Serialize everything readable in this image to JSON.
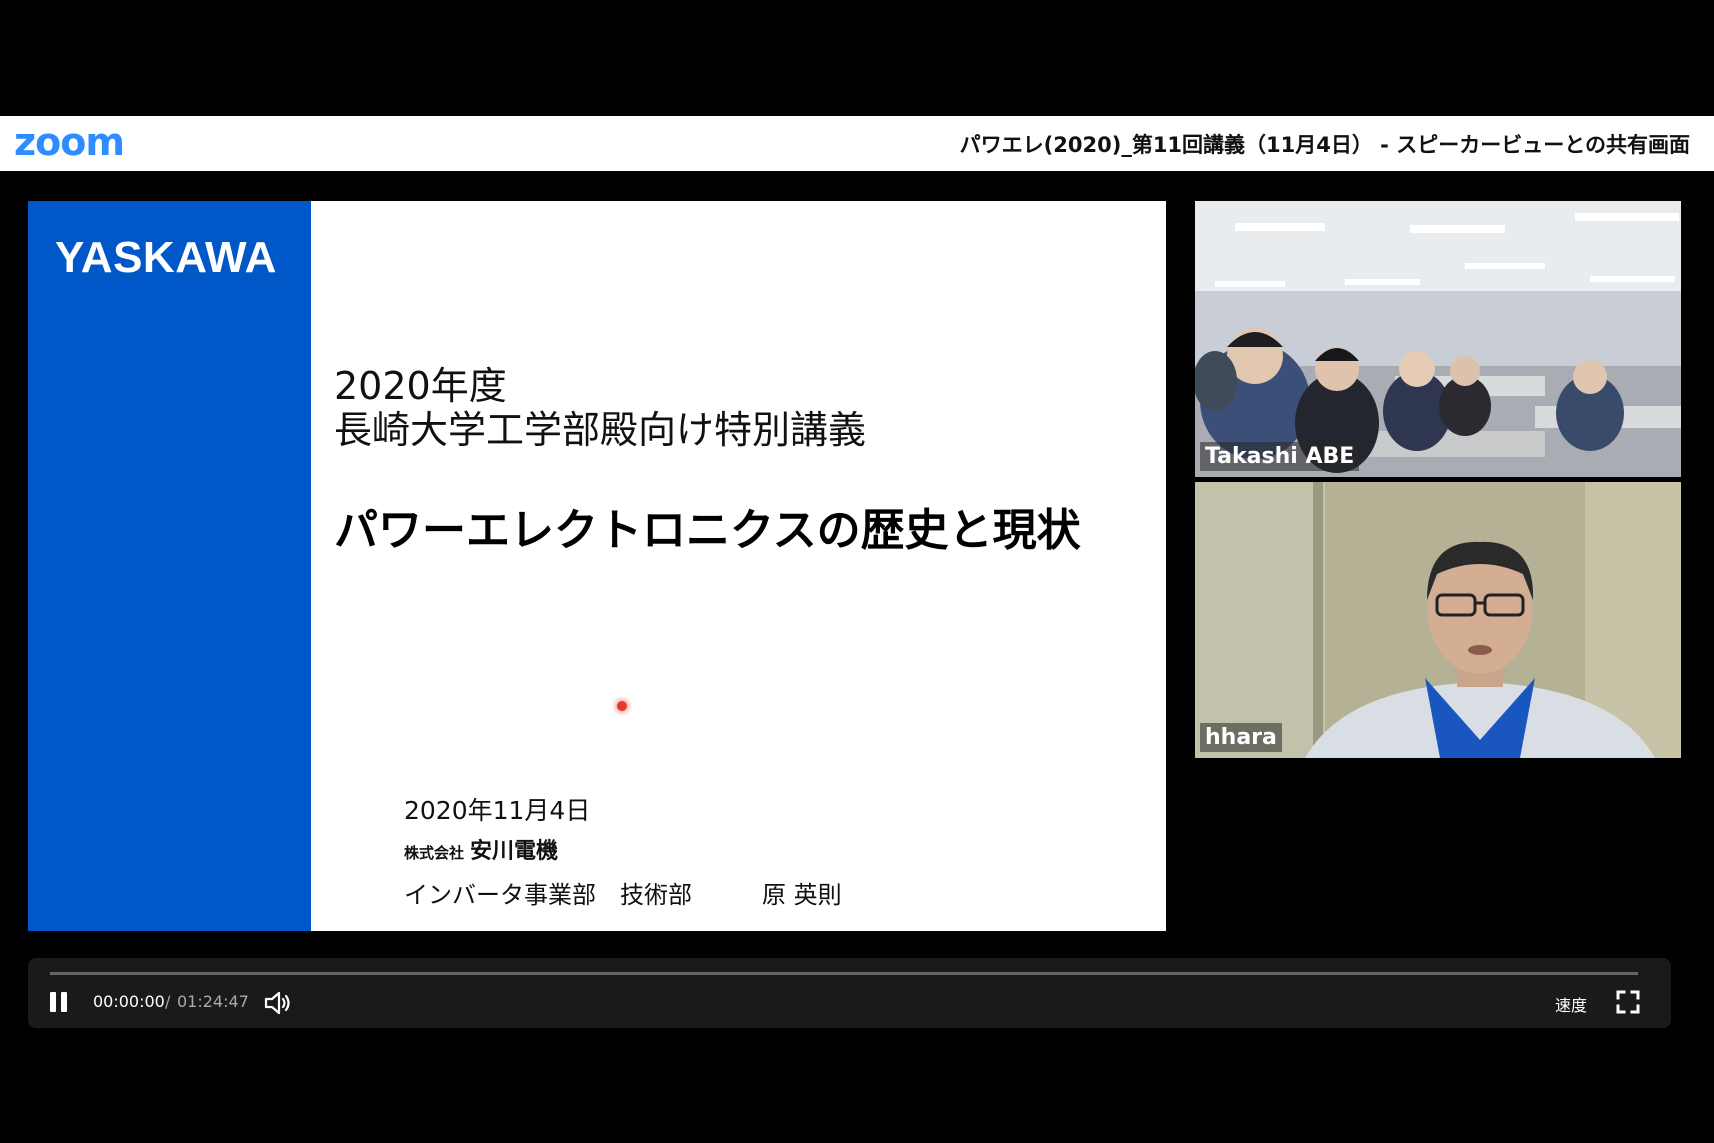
{
  "app": {
    "logo": "zoom",
    "window_title": "パワエレ(2020)_第11回講義（11月4日） - スピーカービューとの共有画面",
    "brand_color": "#2D8CFF"
  },
  "slide": {
    "logo": "YASKAWA",
    "band_color": "#0057C8",
    "year": "2020年度",
    "course": "長崎大学工学部殿向け特別講義",
    "title": "パワーエレクトロニクスの歴史と現状",
    "date": "2020年11月4日",
    "company_prefix": "株式会社",
    "company_name": "安川電機",
    "department": "インバータ事業部　技術部",
    "person": "原 英則"
  },
  "participants": [
    {
      "name": "Takashi ABE"
    },
    {
      "name": "hhara"
    }
  ],
  "player": {
    "state_icon": "pause-icon",
    "current_time": "00:00:00",
    "separator": "/",
    "total_time": "01:24:47",
    "progress": 0,
    "speed_label": "速度",
    "volume_icon": "volume-icon",
    "fullscreen_icon": "fullscreen-icon"
  }
}
